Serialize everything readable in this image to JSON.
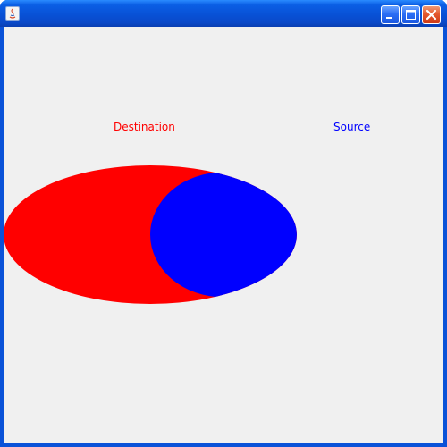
{
  "window": {
    "title": ""
  },
  "title_buttons": {
    "minimize_icon": "minimize-icon",
    "maximize_icon": "maximize-icon",
    "close_icon": "close-icon"
  },
  "labels": {
    "destination": "Destination",
    "source": "Source"
  },
  "colors": {
    "destination": "#ff0000",
    "source": "#0000ff",
    "background": "#f0f0f0"
  },
  "shapes": {
    "destination": "ellipse",
    "source": "ellipse"
  }
}
